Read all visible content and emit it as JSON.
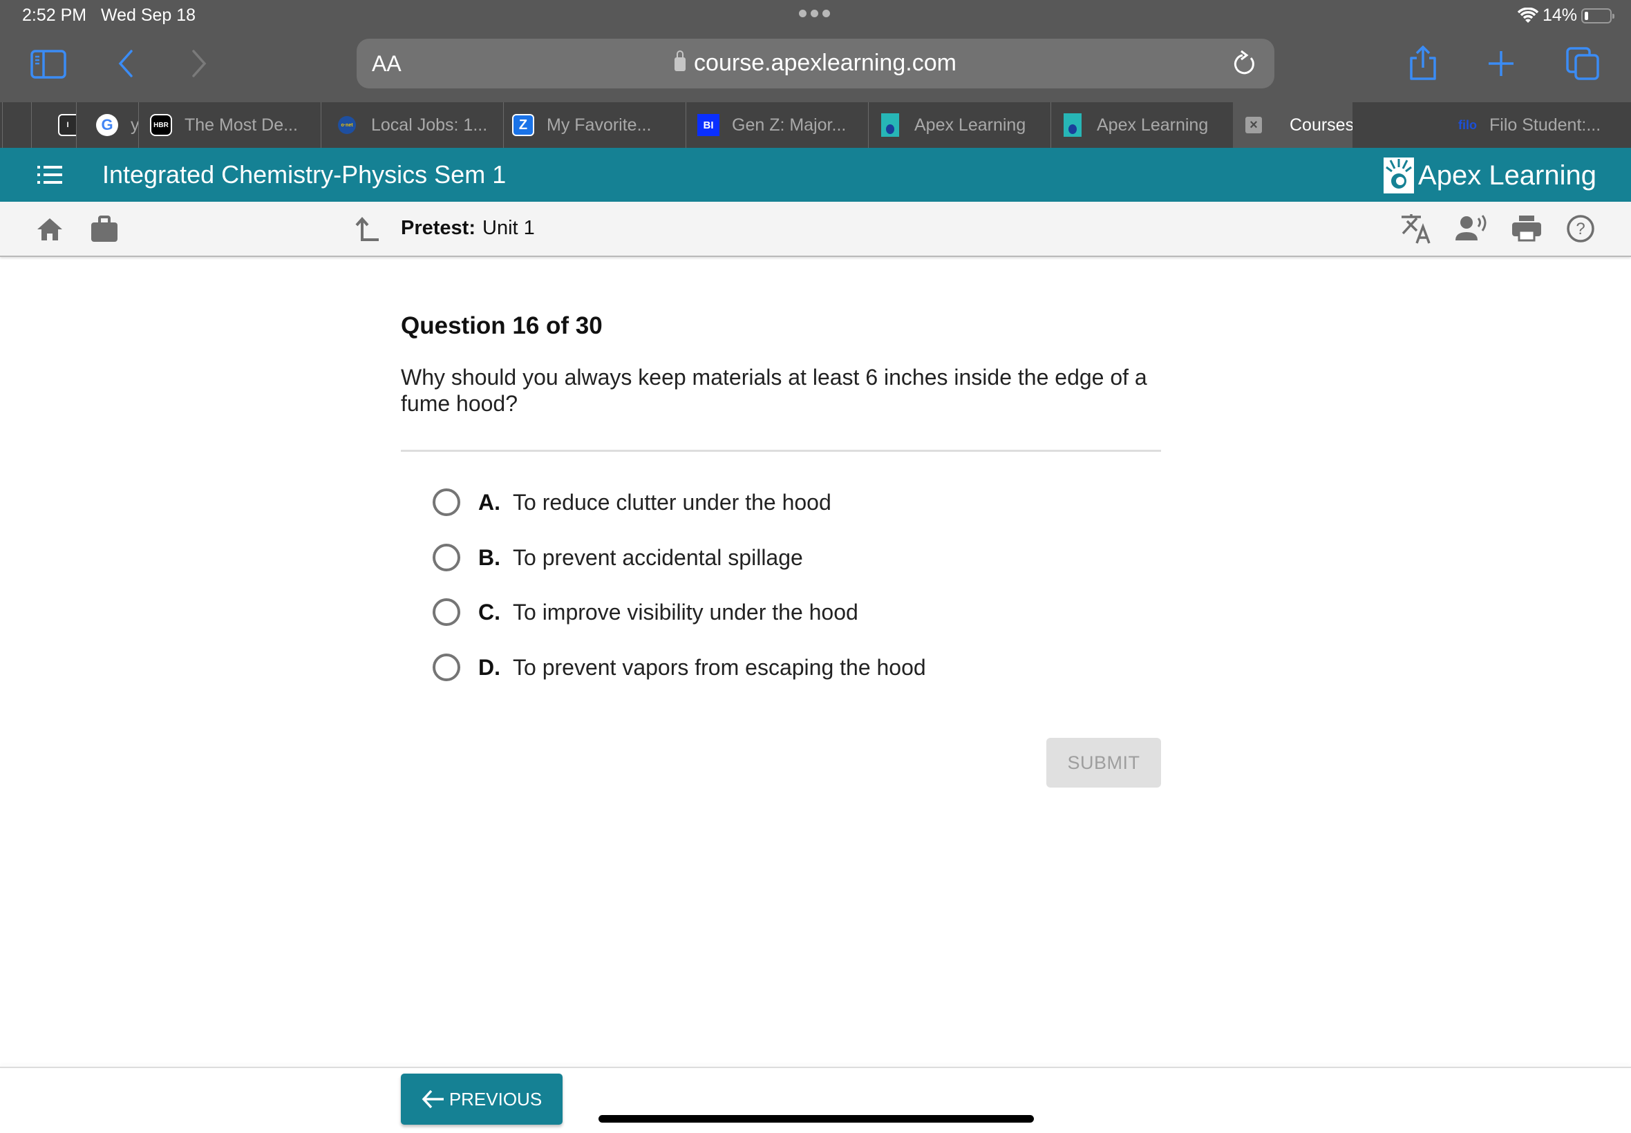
{
  "status_bar": {
    "time": "2:52 PM",
    "date": "Wed Sep 18",
    "battery_percent": "14%",
    "battery_level": 0.14
  },
  "browser": {
    "text_size_label": "AA",
    "url": "course.apexlearning.com",
    "icons": {
      "sidebar": "sidebar-icon",
      "back": "chevron-left-icon",
      "forward": "chevron-right-icon",
      "reload": "reload-icon",
      "share": "share-icon",
      "new_tab": "plus-icon",
      "tabs": "tabs-icon"
    },
    "tabs": [
      {
        "title": "",
        "favicon": "I",
        "favicon_bg": "#2b2b2b",
        "favicon_color": "#ffffff"
      },
      {
        "title": "you u",
        "favicon": "G",
        "favicon_bg": "#ffffff",
        "favicon_color": "#4285f4"
      },
      {
        "title": "The Most De...",
        "favicon": "HBR",
        "favicon_bg": "#000000",
        "favicon_color": "#ffffff"
      },
      {
        "title": "Local Jobs: 1...",
        "favicon": "o·net",
        "favicon_bg": "#1e4fa0",
        "favicon_color": "#f2c200"
      },
      {
        "title": "My Favorite...",
        "favicon": "Z",
        "favicon_bg": "#1a73e8",
        "favicon_color": "#ffffff"
      },
      {
        "title": "Gen Z: Major...",
        "favicon": "BI",
        "favicon_bg": "#0a2fff",
        "favicon_color": "#ffffff"
      },
      {
        "title": "Apex Learning",
        "favicon": "A",
        "favicon_bg": "#27b6b6",
        "favicon_color": "#1a3f9a"
      },
      {
        "title": "Apex Learning",
        "favicon": "A",
        "favicon_bg": "#27b6b6",
        "favicon_color": "#1a3f9a"
      },
      {
        "title": "Courses",
        "favicon": "×",
        "favicon_bg": "#9a9a9a",
        "favicon_color": "#444444",
        "active": true
      },
      {
        "title": "Filo Student:...",
        "favicon": "filo",
        "favicon_bg": "transparent",
        "favicon_color": "#1c4fd8"
      }
    ]
  },
  "app": {
    "course_title": "Integrated Chemistry-Physics Sem 1",
    "brand": "Apex Learning",
    "brand_color": "#158194",
    "breadcrumb": {
      "label": "Pretest:",
      "value": "Unit 1"
    },
    "tools": [
      "translate-icon",
      "read-aloud-icon",
      "print-icon",
      "help-icon"
    ]
  },
  "question": {
    "title": "Question 16 of 30",
    "text": "Why should you always keep materials at least 6 inches inside the edge of a fume hood?",
    "options": [
      {
        "letter": "A.",
        "text": "To reduce clutter under the hood"
      },
      {
        "letter": "B.",
        "text": "To prevent accidental spillage"
      },
      {
        "letter": "C.",
        "text": "To improve visibility under the hood"
      },
      {
        "letter": "D.",
        "text": "To prevent vapors from escaping the hood"
      }
    ],
    "selected": null,
    "submit_label": "SUBMIT"
  },
  "footer": {
    "previous_label": "PREVIOUS"
  }
}
